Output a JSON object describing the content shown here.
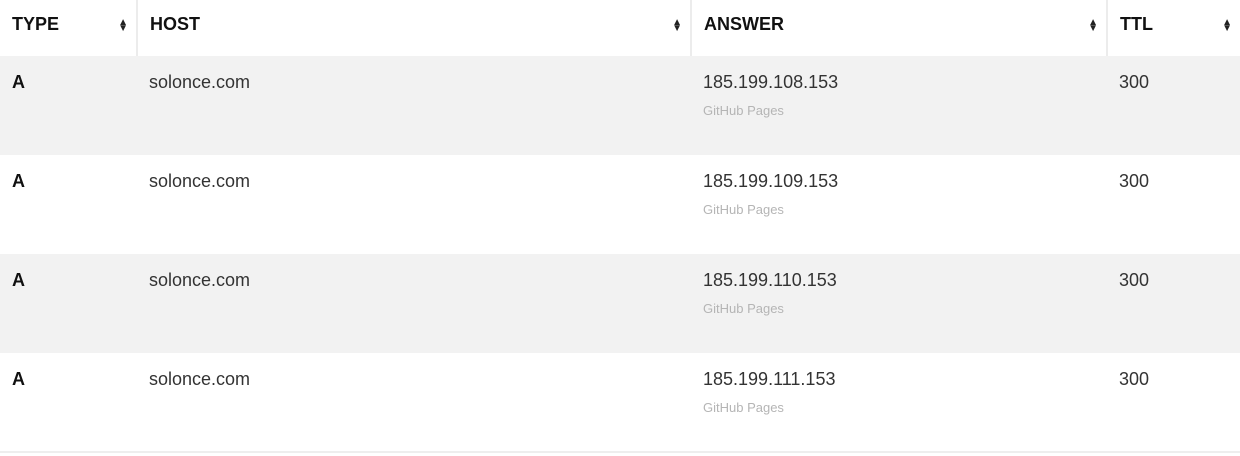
{
  "columns": [
    {
      "label": "TYPE"
    },
    {
      "label": "HOST"
    },
    {
      "label": "ANSWER"
    },
    {
      "label": "TTL"
    }
  ],
  "rows": [
    {
      "type": "A",
      "host": "solonce.com",
      "answer": "185.199.108.153",
      "answer_note": "GitHub Pages",
      "ttl": "300"
    },
    {
      "type": "A",
      "host": "solonce.com",
      "answer": "185.199.109.153",
      "answer_note": "GitHub Pages",
      "ttl": "300"
    },
    {
      "type": "A",
      "host": "solonce.com",
      "answer": "185.199.110.153",
      "answer_note": "GitHub Pages",
      "ttl": "300"
    },
    {
      "type": "A",
      "host": "solonce.com",
      "answer": "185.199.111.153",
      "answer_note": "GitHub Pages",
      "ttl": "300"
    }
  ],
  "icons": {
    "sort": "sort-up-down-icon"
  }
}
